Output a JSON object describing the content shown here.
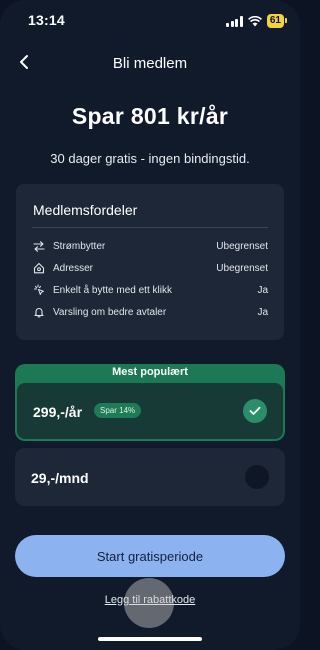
{
  "status_bar": {
    "time": "13:14",
    "battery": "61"
  },
  "header": {
    "title": "Bli medlem"
  },
  "hero": {
    "headline": "Spar 801 kr/år",
    "subline": "30 dager gratis - ingen bindingstid."
  },
  "benefits": {
    "title": "Medlemsfordeler",
    "items": [
      {
        "icon": "swap-arrows-icon",
        "label": "Strømbytter",
        "value": "Ubegrenset"
      },
      {
        "icon": "home-icon",
        "label": "Adresser",
        "value": "Ubegrenset"
      },
      {
        "icon": "tap-click-icon",
        "label": "Enkelt å bytte med ett klikk",
        "value": "Ja"
      },
      {
        "icon": "bell-icon",
        "label": "Varsling om bedre avtaler",
        "value": "Ja"
      }
    ]
  },
  "plans": {
    "popular_label": "Mest populært",
    "yearly": {
      "price": "299,-/år",
      "badge": "Spar 14%",
      "selected": true
    },
    "monthly": {
      "price": "29,-/mnd",
      "selected": false
    }
  },
  "cta": {
    "label": "Start gratisperiode"
  },
  "promo_link": "Legg til rabattkode",
  "colors": {
    "background": "#111a2b",
    "card": "#1d2738",
    "accent_green": "#1b7a55",
    "cta_blue": "#8cb2f0"
  }
}
